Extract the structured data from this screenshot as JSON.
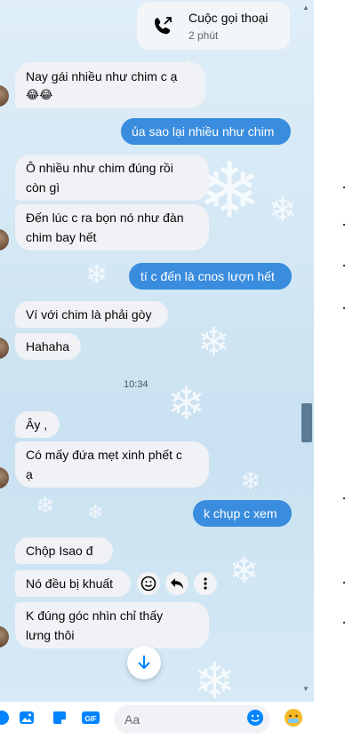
{
  "call": {
    "title": "Cuộc gọi thoại",
    "duration": "2 phút"
  },
  "messages": [
    {
      "side": "in",
      "lines": [
        "Nay gái nhiều như chim c ạ",
        "😂😂"
      ]
    },
    {
      "side": "out",
      "text": "ủa sao lại nhiều như chim"
    },
    {
      "side": "in",
      "lines": [
        "Ô nhiều như chim đúng rồi",
        "còn gì"
      ]
    },
    {
      "side": "in",
      "lines": [
        "Đến lúc c ra bọn nó như đàn",
        "chim bay hết"
      ]
    },
    {
      "side": "out",
      "text": "tí c đến là cnos lượn hết"
    },
    {
      "side": "in",
      "text": "Ví với chim là phải gòy"
    },
    {
      "side": "in",
      "text": "Hahaha"
    },
    {
      "side": "in",
      "text": "Ây ,"
    },
    {
      "side": "in",
      "lines": [
        "Có mấy đứa mẹt xinh phết c",
        "ạ"
      ]
    },
    {
      "side": "out",
      "text": "k chụp c xem"
    },
    {
      "side": "in",
      "text": "Chộp Isao đ"
    },
    {
      "side": "in",
      "text": "Nó đều bị khuất"
    },
    {
      "side": "in",
      "lines": [
        "K đúng góc nhìn chỉ thấy",
        "lưng thôi"
      ]
    }
  ],
  "timestamp": "10:34",
  "composer": {
    "placeholder": "Aa"
  },
  "icons": {
    "call": "phone-outgoing-icon",
    "react": "smile-icon",
    "reply": "reply-icon",
    "more": "more-vertical-icon",
    "scroll": "arrow-down-icon",
    "image": "image-icon",
    "sticker": "sticker-icon",
    "gif": "gif-icon",
    "emoji": "emoji-icon",
    "like": "like-emoji-icon"
  },
  "colors": {
    "outgoing": "#3a8dde",
    "incoming": "#f0f2f5",
    "accent": "#0084ff"
  }
}
